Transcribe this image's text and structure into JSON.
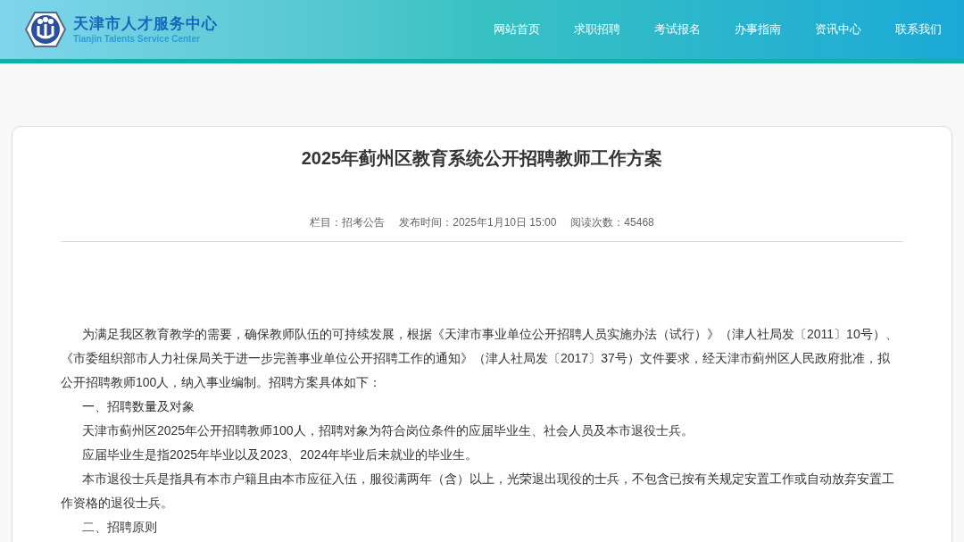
{
  "header": {
    "logo_title": "天津市人才服务中心",
    "logo_subtitle": "Tianjin Talents Service Center",
    "nav": [
      {
        "label": "网站首页"
      },
      {
        "label": "求职招聘"
      },
      {
        "label": "考试报名"
      },
      {
        "label": "办事指南"
      },
      {
        "label": "资讯中心"
      },
      {
        "label": "联系我们"
      }
    ]
  },
  "article": {
    "title": "2025年蓟州区教育系统公开招聘教师工作方案",
    "meta": [
      "栏目：招考公告",
      "发布时间：2025年1月10日 15:00",
      "阅读次数：45468"
    ],
    "paragraphs": [
      "为满足我区教育教学的需要，确保教师队伍的可持续发展，根据《天津市事业单位公开招聘人员实施办法（试行）》（津人社局发〔2011〕10号）、《市委组织部市人力社保局关于进一步完善事业单位公开招聘工作的通知》（津人社局发〔2017〕37号）文件要求，经天津市蓟州区人民政府批准，拟公开招聘教师100人，纳入事业编制。招聘方案具体如下：",
      "一、招聘数量及对象",
      "天津市蓟州区2025年公开招聘教师100人，招聘对象为符合岗位条件的应届毕业生、社会人员及本市退役士兵。",
      "应届毕业生是指2025年毕业以及2023、2024年毕业后未就业的毕业生。",
      "本市退役士兵是指具有本市户籍且由本市应征入伍，服役满两年（含）以上，光荣退出现役的士兵，不包含已按有关规定安置工作或自动放弃安置工作资格的退役士兵。",
      "二、招聘原则"
    ]
  }
}
